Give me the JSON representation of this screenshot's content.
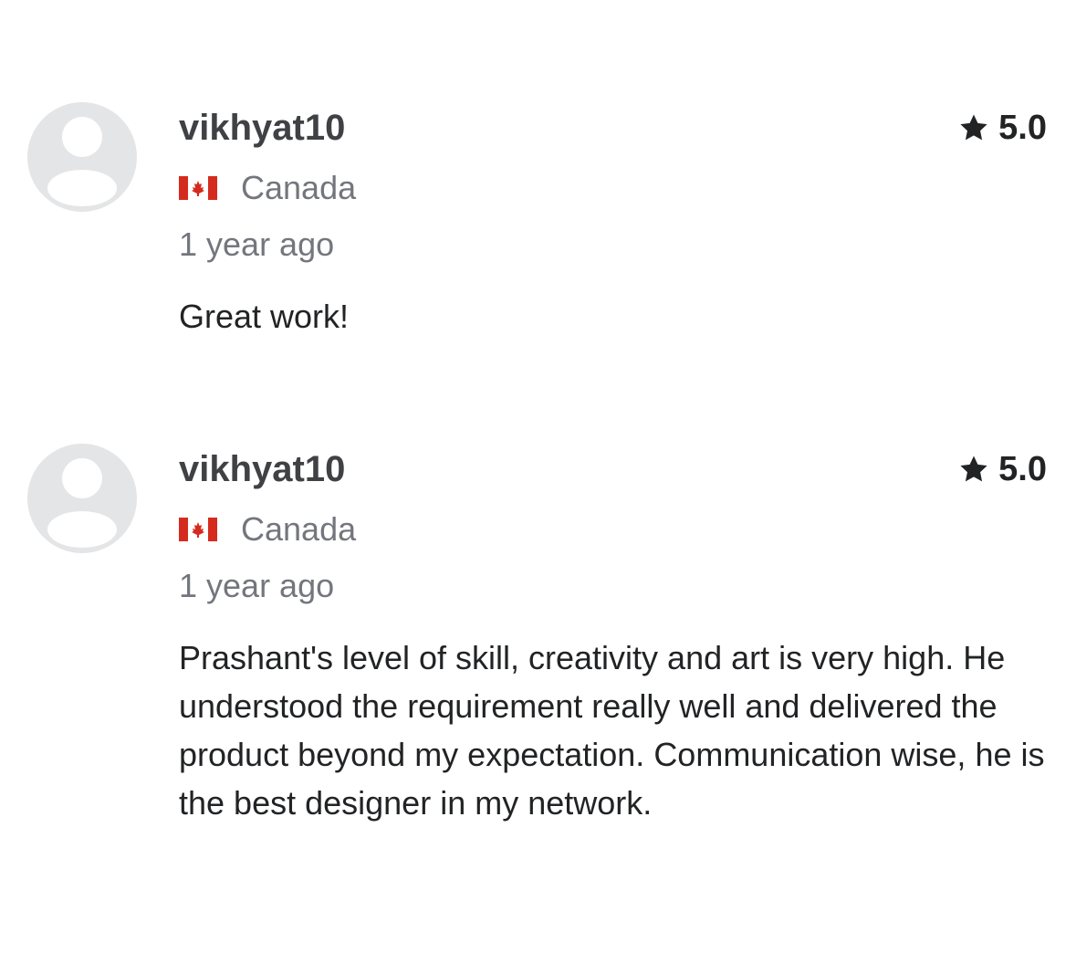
{
  "reviews": [
    {
      "username": "vikhyat10",
      "rating": "5.0",
      "country": "Canada",
      "country_flag_icon": "canada-flag-icon",
      "time": "1 year ago",
      "comment": "Great work!"
    },
    {
      "username": "vikhyat10",
      "rating": "5.0",
      "country": "Canada",
      "country_flag_icon": "canada-flag-icon",
      "time": "1 year ago",
      "comment": "Prashant's level of skill, creativity and art is very high. He understood the requirement really well and delivered the product beyond my expectation. Communication wise, he is the best designer in my network."
    }
  ],
  "colors": {
    "avatar_bg": "#e4e5e7",
    "avatar_fg": "#ffffff",
    "username": "#404145",
    "muted_text": "#74767e",
    "body_text": "#222325",
    "star": "#222325",
    "flag_red": "#d52b1e"
  }
}
